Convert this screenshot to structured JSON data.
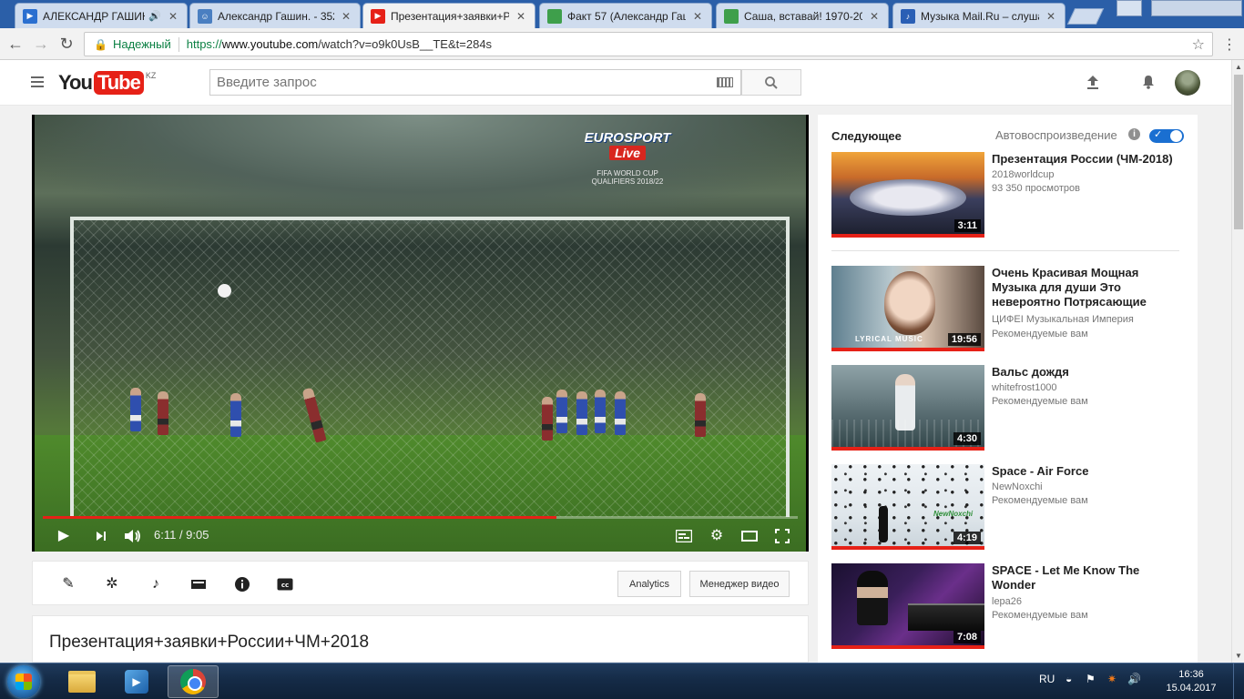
{
  "browser": {
    "tabs": [
      {
        "title": "АЛЕКСАНДР ГАШИН",
        "favicon": "play",
        "color": "#2a6fd0",
        "audio": true
      },
      {
        "title": "Александр Гашин. - 352",
        "favicon": "people",
        "color": "#4a7fc1",
        "audio": false
      },
      {
        "title": "Презентация+заявки+Р",
        "favicon": "youtube",
        "color": "#e62117",
        "audio": false,
        "active": true
      },
      {
        "title": "Факт 57 (Александр Гаш",
        "favicon": "sheet",
        "color": "#3e9f4b",
        "audio": false
      },
      {
        "title": "Саша, вставай! 1970-20",
        "favicon": "sheet",
        "color": "#3e9f4b",
        "audio": false
      },
      {
        "title": "Музыка Mail.Ru – слуша",
        "favicon": "music",
        "color": "#2a5fb5",
        "audio": false
      }
    ],
    "secure_label": "Надежный",
    "url_scheme": "https://",
    "url_host": "www.youtube.com",
    "url_path": "/watch?v=o9k0UsB__TE&t=284s"
  },
  "youtube": {
    "logo_you": "You",
    "logo_tube": "Tube",
    "region": "KZ",
    "search_placeholder": "Введите запрос"
  },
  "player": {
    "broadcast_line1": "EUROSPORT",
    "broadcast_line2": "Live",
    "broadcast_line3": "FIFA WORLD CUP\nQUALIFIERS 2018/22",
    "time_current": "6:11",
    "time_total": "9:05",
    "time_display": "6:11 / 9:05",
    "progress_fraction": 0.68
  },
  "creator_bar": {
    "analytics_label": "Analytics",
    "manager_label": "Менеджер видео"
  },
  "video": {
    "title": "Презентация+заявки+России+ЧМ+2018"
  },
  "sidebar": {
    "up_next_label": "Следующее",
    "autoplay_label": "Автовоспроизведение",
    "autoplay_on": true,
    "items": [
      {
        "title": "Презентация России (ЧМ-2018)",
        "channel": "2018worldcup",
        "meta": "93 350 просмотров",
        "duration": "3:11",
        "thumb": "stadium"
      },
      {
        "title": "Очень Красивая Мощная Музыка для души Это невероятно Потрясающие",
        "channel": "ЦИФЕI Музыкальная Империя",
        "meta": "Рекомендуемые вам",
        "duration": "19:56",
        "thumb": "portrait",
        "thumb_caption": "LYRICAL MUSIC"
      },
      {
        "title": "Вальс дождя",
        "channel": "whitefrost1000",
        "meta": "Рекомендуемые вам",
        "duration": "4:30",
        "thumb": "rain"
      },
      {
        "title": "Space - Air Force",
        "channel": "NewNoxchi",
        "meta": "Рекомендуемые вам",
        "duration": "4:19",
        "thumb": "birds",
        "thumb_caption": "NewNoxchi"
      },
      {
        "title": "SPACE - Let Me Know The Wonder",
        "channel": "lepa26",
        "meta": "Рекомендуемые вам",
        "duration": "7:08",
        "thumb": "piano"
      }
    ]
  },
  "taskbar": {
    "lang": "RU",
    "time": "16:36",
    "date": "15.04.2017"
  }
}
